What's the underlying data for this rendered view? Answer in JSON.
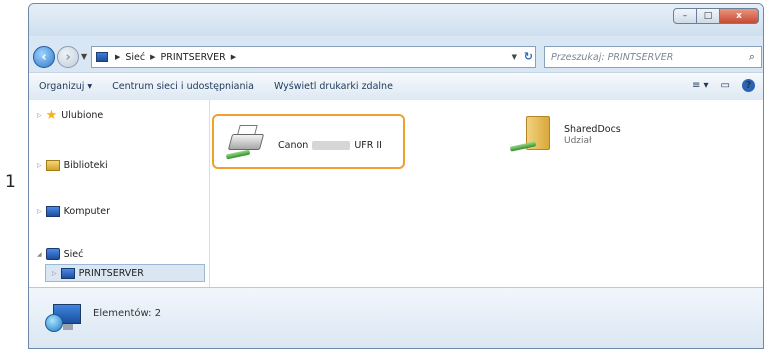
{
  "step_number": "1",
  "window": {
    "controls": {
      "minimize": "–",
      "maximize": "□",
      "close": "x"
    }
  },
  "address": {
    "segments": [
      "Sieć",
      "PRINTSERVER"
    ],
    "search_placeholder": "Przeszukaj: PRINTSERVER"
  },
  "toolbar": {
    "organize": "Organizuj ▾",
    "network_center": "Centrum sieci i udostępniania",
    "view_printers": "Wyświetl drukarki zdalne",
    "view_icon": "≡ ▾",
    "pane_icon": "▭",
    "help_icon": "?"
  },
  "sidebar": {
    "items": [
      {
        "label": "Ulubione",
        "icon": "star-icon"
      },
      {
        "label": "Biblioteki",
        "icon": "library-icon"
      },
      {
        "label": "Komputer",
        "icon": "computer-icon"
      },
      {
        "label": "Sieć",
        "icon": "network-icon"
      }
    ],
    "selected": "PRINTSERVER"
  },
  "content": {
    "printer": {
      "name_prefix": "Canon",
      "name_suffix": "UFR II"
    },
    "share": {
      "name": "SharedDocs",
      "sub": "Udział"
    }
  },
  "details": {
    "count_text": "Elementów: 2"
  },
  "colors": {
    "highlight": "#f0a02c",
    "accent": "#2a64b3"
  }
}
